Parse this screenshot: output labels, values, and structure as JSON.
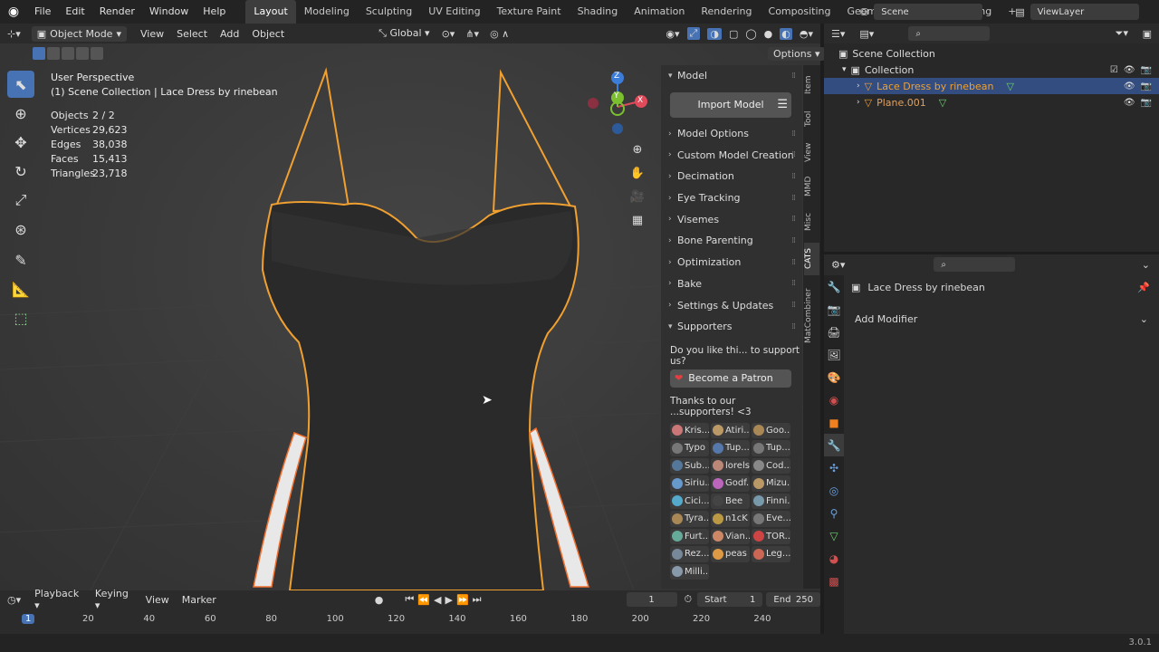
{
  "menu": [
    "File",
    "Edit",
    "Render",
    "Window",
    "Help"
  ],
  "workspaces": [
    "Layout",
    "Modeling",
    "Sculpting",
    "UV Editing",
    "Texture Paint",
    "Shading",
    "Animation",
    "Rendering",
    "Compositing",
    "Geometry Nodes",
    "Scripting"
  ],
  "active_workspace": "Layout",
  "scene_label": "Scene",
  "viewlayer_label": "ViewLayer",
  "viewport": {
    "mode": "Object Mode",
    "menus": [
      "View",
      "Select",
      "Add",
      "Object"
    ],
    "transform_orientation": "Global",
    "options_label": "Options",
    "title": "User Perspective",
    "subtitle": "(1) Scene Collection | Lace Dress by rinebean",
    "gizmo": {
      "z": "Z",
      "y": "Y",
      "x": "X"
    }
  },
  "stats": [
    {
      "k": "Objects",
      "v": "2 / 2"
    },
    {
      "k": "Vertices",
      "v": "29,623"
    },
    {
      "k": "Edges",
      "v": "38,038"
    },
    {
      "k": "Faces",
      "v": "15,413"
    },
    {
      "k": "Triangles",
      "v": "23,718"
    }
  ],
  "npanel": {
    "model_header": "Model",
    "import_label": "Import Model",
    "sections": [
      "Model Options",
      "Custom Model Creation",
      "Decimation",
      "Eye Tracking",
      "Visemes",
      "Bone Parenting",
      "Optimization",
      "Bake",
      "Settings & Updates"
    ],
    "supporters_header": "Supporters",
    "support_question": "Do you like thi... to support us?",
    "patron_label": "Become a Patron",
    "thanks": "Thanks to our ...supporters! <3",
    "supporters": [
      "Kris...",
      "Atiri...",
      "Goo...",
      "Typo",
      "Tup...",
      "Tup...",
      "Sub...",
      "lorels1",
      "Cod...",
      "Siriu...",
      "Godf...",
      "Mizu...",
      "Cici...",
      "Bee",
      "Finni...",
      "Tyra...",
      "n1cK",
      "Eve...",
      "Furt...",
      "Vian...",
      "TOR...",
      "Rez...",
      "peas",
      "Leg...",
      "Milli..."
    ],
    "tabs": [
      "Item",
      "Tool",
      "View",
      "MMD",
      "Misc",
      "CATS",
      "MatCombiner"
    ],
    "active_tab": "CATS"
  },
  "outliner": {
    "root": "Scene Collection",
    "collection": "Collection",
    "items": [
      "Lace Dress by rinebean",
      "Plane.001"
    ]
  },
  "properties": {
    "object_name": "Lace Dress by rinebean",
    "add_modifier": "Add Modifier"
  },
  "timeline": {
    "menus": [
      "Playback",
      "Keying",
      "View",
      "Marker"
    ],
    "current_frame": "1",
    "start_label": "Start",
    "start": "1",
    "end_label": "End",
    "end": "250",
    "ticks": [
      "1",
      "20",
      "40",
      "60",
      "80",
      "100",
      "120",
      "140",
      "160",
      "180",
      "200",
      "220",
      "240"
    ]
  },
  "version": "3.0.1",
  "colors": {
    "accent": "#4772b3",
    "selection_outline": "#f0a030",
    "patron_heart": "#e04040"
  }
}
